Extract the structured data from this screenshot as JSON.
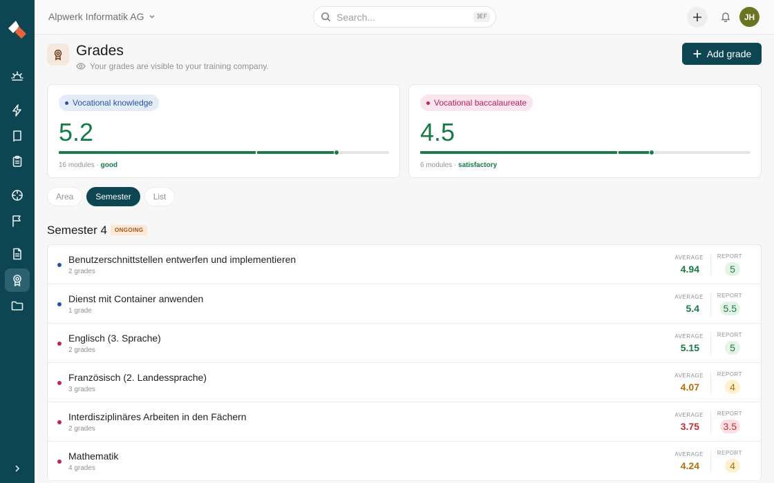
{
  "topbar": {
    "org_name": "Alpwerk Informatik AG",
    "search_placeholder": "Search...",
    "search_shortcut": "⌘F",
    "avatar_initials": "JH"
  },
  "header": {
    "title": "Grades",
    "subtitle": "Your grades are visible to your training company.",
    "add_button_label": "Add grade"
  },
  "summary_cards": [
    {
      "label": "Vocational knowledge",
      "value": "5.2",
      "modules": "16 modules",
      "quality": "good",
      "progress_fraction": 0.84,
      "accent": "#2553a8"
    },
    {
      "label": "Vocational baccalaureate",
      "value": "4.5",
      "modules": "6 modules",
      "quality": "satisfactory",
      "progress_fraction": 0.7,
      "accent": "#c6215e"
    }
  ],
  "meta_separator": "·",
  "view_toggle": {
    "options": [
      "Area",
      "Semester",
      "List"
    ],
    "selected": "Semester"
  },
  "semester": {
    "title": "Semester 4",
    "badge": "ONGOING"
  },
  "labels": {
    "average": "AVERAGE",
    "report": "REPORT"
  },
  "subjects": [
    {
      "name": "Benutzerschnittstellen entwerfen und implementieren",
      "grades": "2 grades",
      "average": "4.94",
      "report": "5",
      "category": "vocational",
      "status": "good"
    },
    {
      "name": "Dienst mit Container anwenden",
      "grades": "1 grade",
      "average": "5.4",
      "report": "5.5",
      "category": "vocational",
      "status": "good"
    },
    {
      "name": "Englisch (3. Sprache)",
      "grades": "2 grades",
      "average": "5.15",
      "report": "5",
      "category": "baccalaureate",
      "status": "good"
    },
    {
      "name": "Französisch (2. Landessprache)",
      "grades": "3 grades",
      "average": "4.07",
      "report": "4",
      "category": "baccalaureate",
      "status": "ok"
    },
    {
      "name": "Interdisziplinäres Arbeiten in den Fächern",
      "grades": "2 grades",
      "average": "3.75",
      "report": "3.5",
      "category": "baccalaureate",
      "status": "bad"
    },
    {
      "name": "Mathematik",
      "grades": "4 grades",
      "average": "4.24",
      "report": "4",
      "category": "baccalaureate",
      "status": "ok"
    }
  ],
  "colors": {
    "primary": "#0d4652",
    "good": "#167a45",
    "good_bg": "#e2f4e8",
    "ok": "#b0700e",
    "ok_bg": "#fcf0cf",
    "bad": "#c62a3a",
    "bad_bg": "#fbe0e2",
    "vocational_dot": "#2553a8",
    "baccalaureate_dot": "#c6215e"
  }
}
